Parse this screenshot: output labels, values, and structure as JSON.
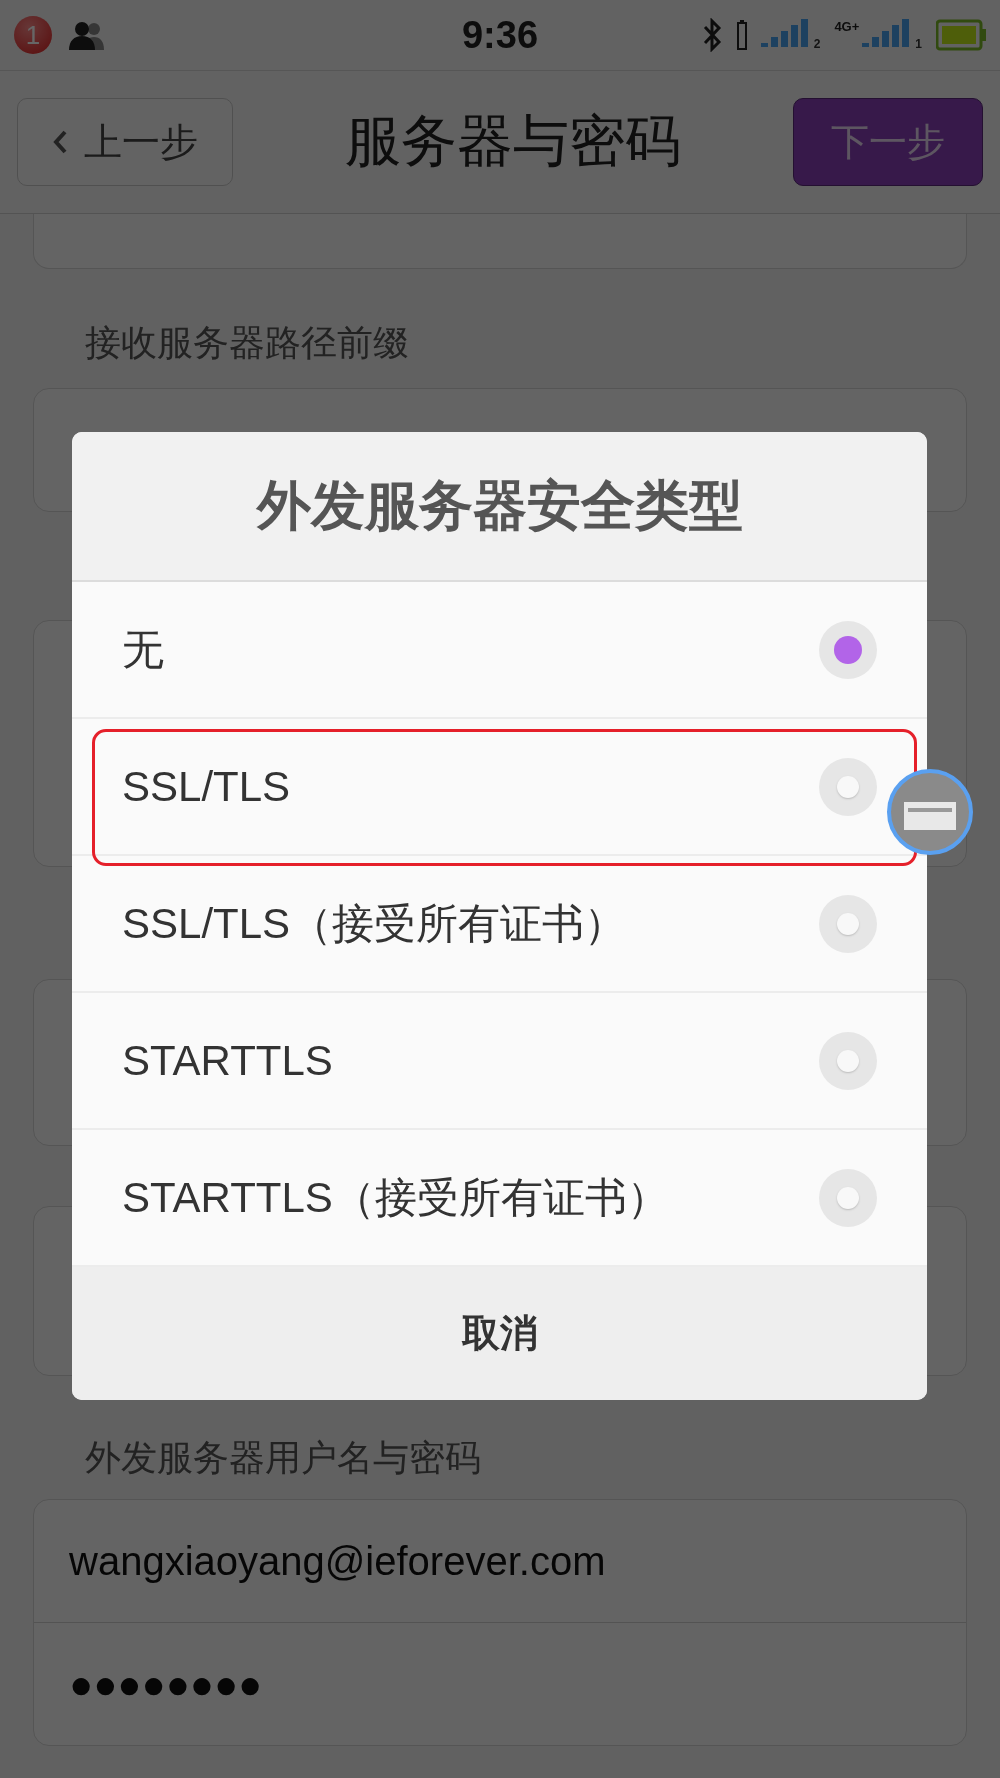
{
  "status_bar": {
    "badge": "1",
    "time": "9:36",
    "signals": [
      {
        "sim": "2"
      },
      {
        "sim": "1",
        "network": "4G+"
      }
    ]
  },
  "header": {
    "back_button": "上一步",
    "title": "服务器与密码",
    "next_button": "下一步"
  },
  "form": {
    "receive_path_label": "接收服务器路径前缀",
    "outgoing_credentials_label": "外发服务器用户名与密码",
    "username": "wangxiaoyang@ieforever.com",
    "password": "●●●●●●●●"
  },
  "dialog": {
    "title": "外发服务器安全类型",
    "options": [
      {
        "label": "无",
        "selected": true
      },
      {
        "label": "SSL/TLS",
        "selected": false,
        "highlighted": true
      },
      {
        "label": "SSL/TLS（接受所有证书）",
        "selected": false
      },
      {
        "label": "STARTTLS",
        "selected": false
      },
      {
        "label": "STARTTLS（接受所有证书）",
        "selected": false
      }
    ],
    "cancel_button": "取消"
  }
}
